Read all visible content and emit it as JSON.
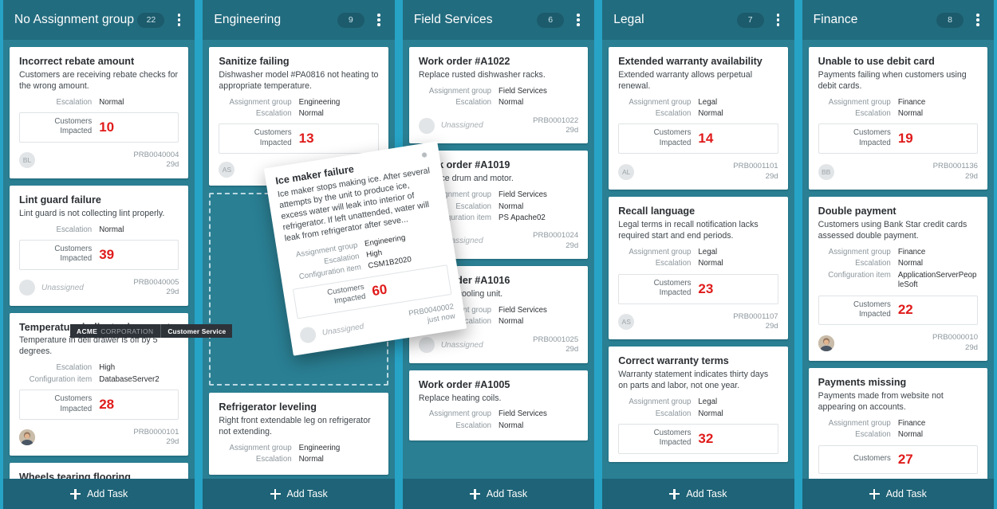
{
  "board": {
    "background_color": "#27a3c6",
    "column_color": "#2a7f93",
    "header_color": "#226c7f",
    "accent_red": "#e01b1b",
    "add_task_label": "Add Task",
    "menu_icon": "kebab-menu-icon",
    "add_icon": "plus-icon"
  },
  "labels": {
    "assignment_group": "Assignment group",
    "escalation": "Escalation",
    "configuration_item": "Configuration item",
    "customers_impacted": "Customers Impacted",
    "unassigned": "Unassigned"
  },
  "tooltip": {
    "brand": "ACME",
    "brand_sub": "CORPORATION",
    "section": "Customer Service"
  },
  "columns": [
    {
      "title": "No Assignment group",
      "count": "22",
      "cards": [
        {
          "title": "Incorrect rebate amount",
          "desc": "Customers are receiving rebate checks for the wrong amount.",
          "fields": [
            {
              "label": "Escalation",
              "value": "Normal"
            }
          ],
          "impact_label": "Customers Impacted",
          "impact": "10",
          "avatar": "BL",
          "avatar_type": "initials",
          "assignee": "",
          "ref": "PRB0040004",
          "age": "29d"
        },
        {
          "title": "Lint guard failure",
          "desc": "Lint guard is not collecting lint properly.",
          "fields": [
            {
              "label": "Escalation",
              "value": "Normal"
            }
          ],
          "impact_label": "Customers Impacted",
          "impact": "39",
          "avatar": "",
          "avatar_type": "empty",
          "assignee": "Unassigned",
          "ref": "PRB0040005",
          "age": "29d"
        },
        {
          "title": "Temperature indicator incorrect",
          "desc": "Temperature in deli drawer is off by 5 degrees.",
          "fields": [
            {
              "label": "Escalation",
              "value": "High"
            },
            {
              "label": "Configuration item",
              "value": "DatabaseServer2"
            }
          ],
          "impact_label": "Customers Impacted",
          "impact": "28",
          "avatar": "",
          "avatar_type": "photo",
          "assignee": "",
          "ref": "PRB0000101",
          "age": "29d"
        },
        {
          "title": "Wheels tearing flooring",
          "desc": "",
          "fields": [],
          "impact_label": "",
          "impact": "",
          "avatar": "",
          "avatar_type": "none",
          "assignee": "",
          "ref": "",
          "age": ""
        }
      ]
    },
    {
      "title": "Engineering",
      "count": "9",
      "cards": [
        {
          "title": "Sanitize failing",
          "desc": "Dishwasher model #PA0816 not heating to appropriate temperature.",
          "fields": [
            {
              "label": "Assignment group",
              "value": "Engineering"
            },
            {
              "label": "Escalation",
              "value": "Normal"
            }
          ],
          "impact_label": "Customers Impacted",
          "impact": "13",
          "avatar": "AS",
          "avatar_type": "initials",
          "assignee": "",
          "ref": "",
          "age": ""
        },
        {
          "title": "Refrigerator leveling",
          "desc": "Right front extendable leg on refrigerator not extending.",
          "fields": [
            {
              "label": "Assignment group",
              "value": "Engineering"
            },
            {
              "label": "Escalation",
              "value": "Normal"
            }
          ],
          "impact_label": "",
          "impact": "",
          "avatar": "",
          "avatar_type": "none",
          "assignee": "",
          "ref": "",
          "age": ""
        }
      ]
    },
    {
      "title": "Field Services",
      "count": "6",
      "cards": [
        {
          "title": "Work order #A1022",
          "desc": "Replace rusted dishwasher racks.",
          "fields": [
            {
              "label": "Assignment group",
              "value": "Field Services"
            },
            {
              "label": "Escalation",
              "value": "Normal"
            }
          ],
          "impact_label": "",
          "impact": "",
          "avatar": "",
          "avatar_type": "empty",
          "assignee": "Unassigned",
          "ref": "PRB0001022",
          "age": "29d"
        },
        {
          "title": "Work order #A1019",
          "desc": "Replace drum and motor.",
          "fields": [
            {
              "label": "Assignment group",
              "value": "Field Services"
            },
            {
              "label": "Escalation",
              "value": "Normal"
            },
            {
              "label": "Configuration item",
              "value": "PS Apache02"
            }
          ],
          "impact_label": "",
          "impact": "",
          "avatar": "",
          "avatar_type": "empty",
          "assignee": "Unassigned",
          "ref": "PRB0001024",
          "age": "29d"
        },
        {
          "title": "Work order #A1016",
          "desc": "Recharge cooling unit.",
          "fields": [
            {
              "label": "Assignment group",
              "value": "Field Services"
            },
            {
              "label": "Escalation",
              "value": "Normal"
            }
          ],
          "impact_label": "",
          "impact": "",
          "avatar": "",
          "avatar_type": "empty",
          "assignee": "Unassigned",
          "ref": "PRB0001025",
          "age": "29d"
        },
        {
          "title": "Work order #A1005",
          "desc": "Replace heating coils.",
          "fields": [
            {
              "label": "Assignment group",
              "value": "Field Services"
            },
            {
              "label": "Escalation",
              "value": "Normal"
            }
          ],
          "impact_label": "",
          "impact": "",
          "avatar": "",
          "avatar_type": "none",
          "assignee": "",
          "ref": "",
          "age": ""
        }
      ]
    },
    {
      "title": "Legal",
      "count": "7",
      "cards": [
        {
          "title": "Extended warranty availability",
          "desc": "Extended warranty allows perpetual renewal.",
          "fields": [
            {
              "label": "Assignment group",
              "value": "Legal"
            },
            {
              "label": "Escalation",
              "value": "Normal"
            }
          ],
          "impact_label": "Customers Impacted",
          "impact": "14",
          "avatar": "AL",
          "avatar_type": "initials",
          "assignee": "",
          "ref": "PRB0001101",
          "age": "29d"
        },
        {
          "title": "Recall language",
          "desc": "Legal terms in recall notification lacks required start and end periods.",
          "fields": [
            {
              "label": "Assignment group",
              "value": "Legal"
            },
            {
              "label": "Escalation",
              "value": "Normal"
            }
          ],
          "impact_label": "Customers Impacted",
          "impact": "23",
          "avatar": "AS",
          "avatar_type": "initials",
          "assignee": "",
          "ref": "PRB0001107",
          "age": "29d"
        },
        {
          "title": "Correct warranty terms",
          "desc": "Warranty statement indicates thirty days on parts and labor, not one year.",
          "fields": [
            {
              "label": "Assignment group",
              "value": "Legal"
            },
            {
              "label": "Escalation",
              "value": "Normal"
            }
          ],
          "impact_label": "Customers Impacted",
          "impact": "32",
          "avatar": "",
          "avatar_type": "none",
          "assignee": "",
          "ref": "",
          "age": ""
        }
      ]
    },
    {
      "title": "Finance",
      "count": "8",
      "cards": [
        {
          "title": "Unable to use debit card",
          "desc": "Payments failing when customers using debit cards.",
          "fields": [
            {
              "label": "Assignment group",
              "value": "Finance"
            },
            {
              "label": "Escalation",
              "value": "Normal"
            }
          ],
          "impact_label": "Customers Impacted",
          "impact": "19",
          "avatar": "BB",
          "avatar_type": "initials",
          "assignee": "",
          "ref": "PRB0001136",
          "age": "29d"
        },
        {
          "title": "Double payment",
          "desc": "Customers using Bank Star credit cards assessed double payment.",
          "fields": [
            {
              "label": "Assignment group",
              "value": "Finance"
            },
            {
              "label": "Escalation",
              "value": "Normal"
            },
            {
              "label": "Configuration item",
              "value": "ApplicationServerPeopleSoft"
            }
          ],
          "impact_label": "Customers Impacted",
          "impact": "22",
          "avatar": "",
          "avatar_type": "photo",
          "assignee": "",
          "ref": "PRB0000010",
          "age": "29d"
        },
        {
          "title": "Payments missing",
          "desc": "Payments made from website not appearing on accounts.",
          "fields": [
            {
              "label": "Assignment group",
              "value": "Finance"
            },
            {
              "label": "Escalation",
              "value": "Normal"
            }
          ],
          "impact_label": "Customers",
          "impact": "27",
          "avatar": "",
          "avatar_type": "none",
          "assignee": "",
          "ref": "",
          "age": ""
        }
      ]
    }
  ],
  "drag_card": {
    "title": "Ice maker failure",
    "desc": "Ice maker stops making ice. After several attempts by the unit to produce ice, excess water will leak into interior of refrigerator. If left unattended, water will leak from refrigerator after seve...",
    "fields": [
      {
        "label": "Assignment group",
        "value": "Engineering"
      },
      {
        "label": "Escalation",
        "value": "High"
      },
      {
        "label": "Configuration item",
        "value": "CSM1B2020"
      }
    ],
    "impact_label": "Customers Impacted",
    "impact": "60",
    "assignee": "Unassigned",
    "ref": "PRB0040002",
    "age": "just now",
    "gear_icon": "gear-icon"
  }
}
